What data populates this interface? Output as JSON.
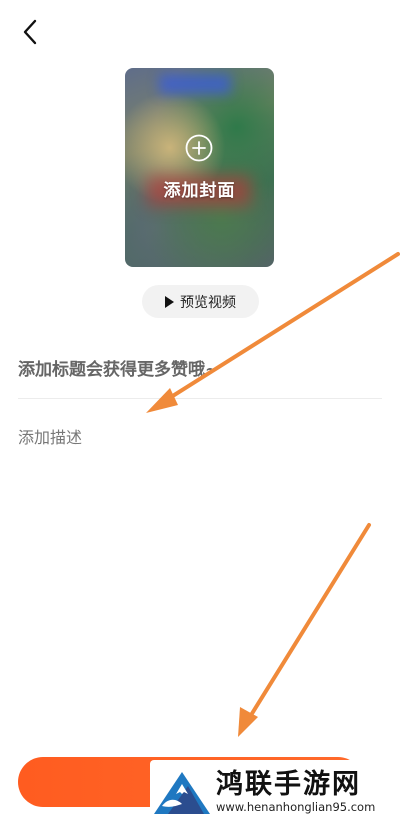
{
  "cover": {
    "label": "添加封面",
    "add_icon": "plus-circle-icon"
  },
  "preview": {
    "label": "预览视频",
    "icon": "play-icon"
  },
  "form": {
    "title_placeholder": "添加标题会获得更多赞哦~",
    "description_placeholder": "添加描述"
  },
  "publish_button": {
    "color": "#ff5c20"
  },
  "annotations": {
    "arrow_color": "#f08a3a"
  },
  "watermark": {
    "name": "鸿联手游网",
    "url": "www.henanhonglian95.com"
  },
  "icons": {
    "back": "chevron-left-icon"
  }
}
